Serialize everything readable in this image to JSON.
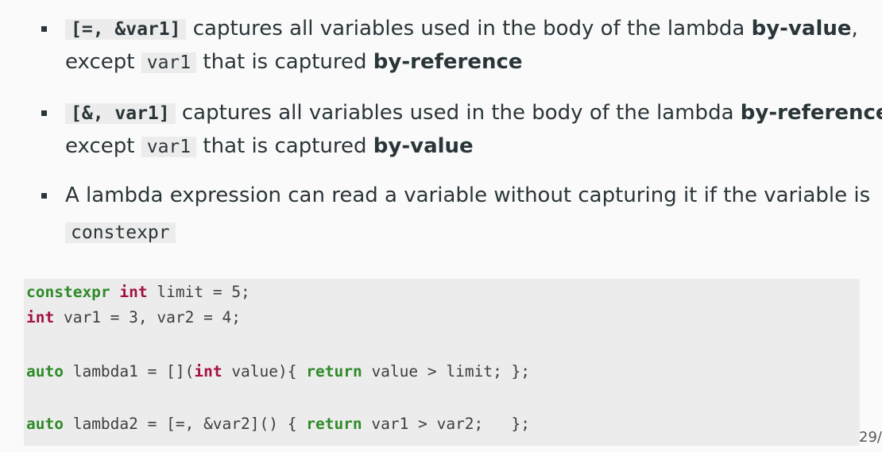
{
  "bullets": [
    {
      "line1": {
        "code": "[=, &var1]",
        "text_a": " captures all variables used in the body of the lambda ",
        "bold": "by-value",
        "text_b": ","
      },
      "line2": {
        "text_a": "except ",
        "code": "var1",
        "text_b": " that is captured ",
        "bold": "by-reference"
      }
    },
    {
      "line1": {
        "code": "[&, var1]",
        "text_a": " captures all variables used in the body of the lambda ",
        "bold": "by-reference",
        "text_b": ","
      },
      "line2": {
        "text_a": "except ",
        "code": "var1",
        "text_b": " that is captured ",
        "bold": "by-value"
      }
    },
    {
      "line1": {
        "text_a": "A lambda expression can read a variable without capturing it if the variable is"
      },
      "line2": {
        "code": "constexpr"
      }
    }
  ],
  "code_block": {
    "line1": {
      "kw1": "constexpr",
      "kw2": "int",
      "rest": " limit = 5;"
    },
    "line2": {
      "kw1": "int",
      "rest": " var1 = 3, var2 = 4;"
    },
    "line3": {
      "kw1": "auto",
      "a": " lambda1 = [](",
      "kw2": "int",
      "b": " value){ ",
      "kw3": "return",
      "c": " value > limit; };"
    },
    "line4": {
      "kw1": "auto",
      "a": " lambda2 = [=, &var2]() { ",
      "kw3": "return",
      "c": " var1 > var2;   };"
    }
  },
  "page_number": "29/"
}
